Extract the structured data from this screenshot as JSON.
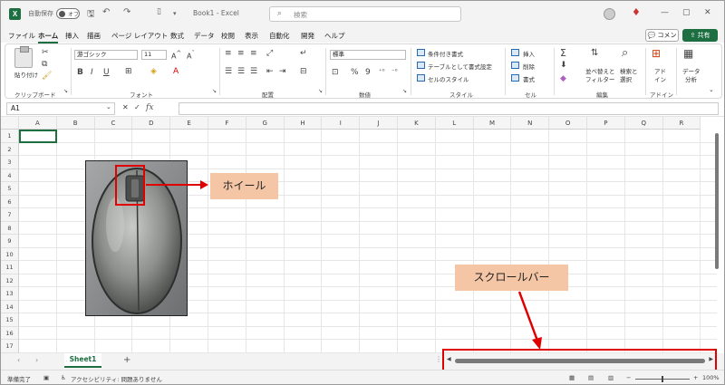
{
  "titlebar": {
    "autosave_label": "自動保存",
    "autosave_state": "オフ",
    "doc_title": "Book1 - Excel",
    "search_placeholder": "検索",
    "minimize": "—",
    "restore": "▢",
    "close": "✕"
  },
  "menu": {
    "tabs": [
      "ファイル",
      "ホーム",
      "挿入",
      "描画",
      "ページ レイアウト",
      "数式",
      "データ",
      "校閲",
      "表示",
      "自動化",
      "開発",
      "ヘルプ"
    ],
    "active_tab": "ホーム",
    "comment_label": "コメント",
    "share_label": "共有"
  },
  "ribbon": {
    "clipboard": {
      "label": "クリップボード",
      "paste": "貼り付け"
    },
    "font": {
      "label": "フォント",
      "font_name": "游ゴシック",
      "font_size": "11",
      "bold": "B",
      "italic": "I",
      "underline": "U"
    },
    "alignment": {
      "label": "配置"
    },
    "number": {
      "label": "数値",
      "format": "標準",
      "percent": "%",
      "comma": "9"
    },
    "styles": {
      "label": "スタイル",
      "conditional": "条件付き書式",
      "table": "テーブルとして書式設定",
      "cell_styles": "セルのスタイル"
    },
    "cells": {
      "label": "セル",
      "insert": "挿入",
      "delete": "削除",
      "format": "書式"
    },
    "editing": {
      "label": "編集",
      "sort": "並べ替えと",
      "sort2": "フィルター",
      "find": "検索と",
      "find2": "選択"
    },
    "addins": {
      "label": "アドイン",
      "addin": "アド",
      "addin2": "イン"
    },
    "analysis": {
      "label": "データ",
      "label2": "分析"
    }
  },
  "formula_bar": {
    "name_box": "A1",
    "fx": "fx",
    "value": ""
  },
  "grid": {
    "columns": [
      "A",
      "B",
      "C",
      "D",
      "E",
      "F",
      "G",
      "H",
      "I",
      "J",
      "K",
      "L",
      "M",
      "N",
      "O",
      "P",
      "Q",
      "R"
    ],
    "rows": [
      "1",
      "2",
      "3",
      "4",
      "5",
      "6",
      "7",
      "8",
      "9",
      "10",
      "11",
      "12",
      "13",
      "14",
      "15",
      "16",
      "17"
    ]
  },
  "callouts": {
    "wheel": "ホイール",
    "scrollbar": "スクロールバー"
  },
  "sheetbar": {
    "sheet_name": "Sheet1",
    "add": "+"
  },
  "status": {
    "ready": "準備完了",
    "accessibility": "アクセシビリティ: 問題ありません",
    "zoom": "100%"
  },
  "colors": {
    "accent": "#1d6f42",
    "highlight": "#e00000",
    "callout_bg": "#f4c6a6"
  }
}
